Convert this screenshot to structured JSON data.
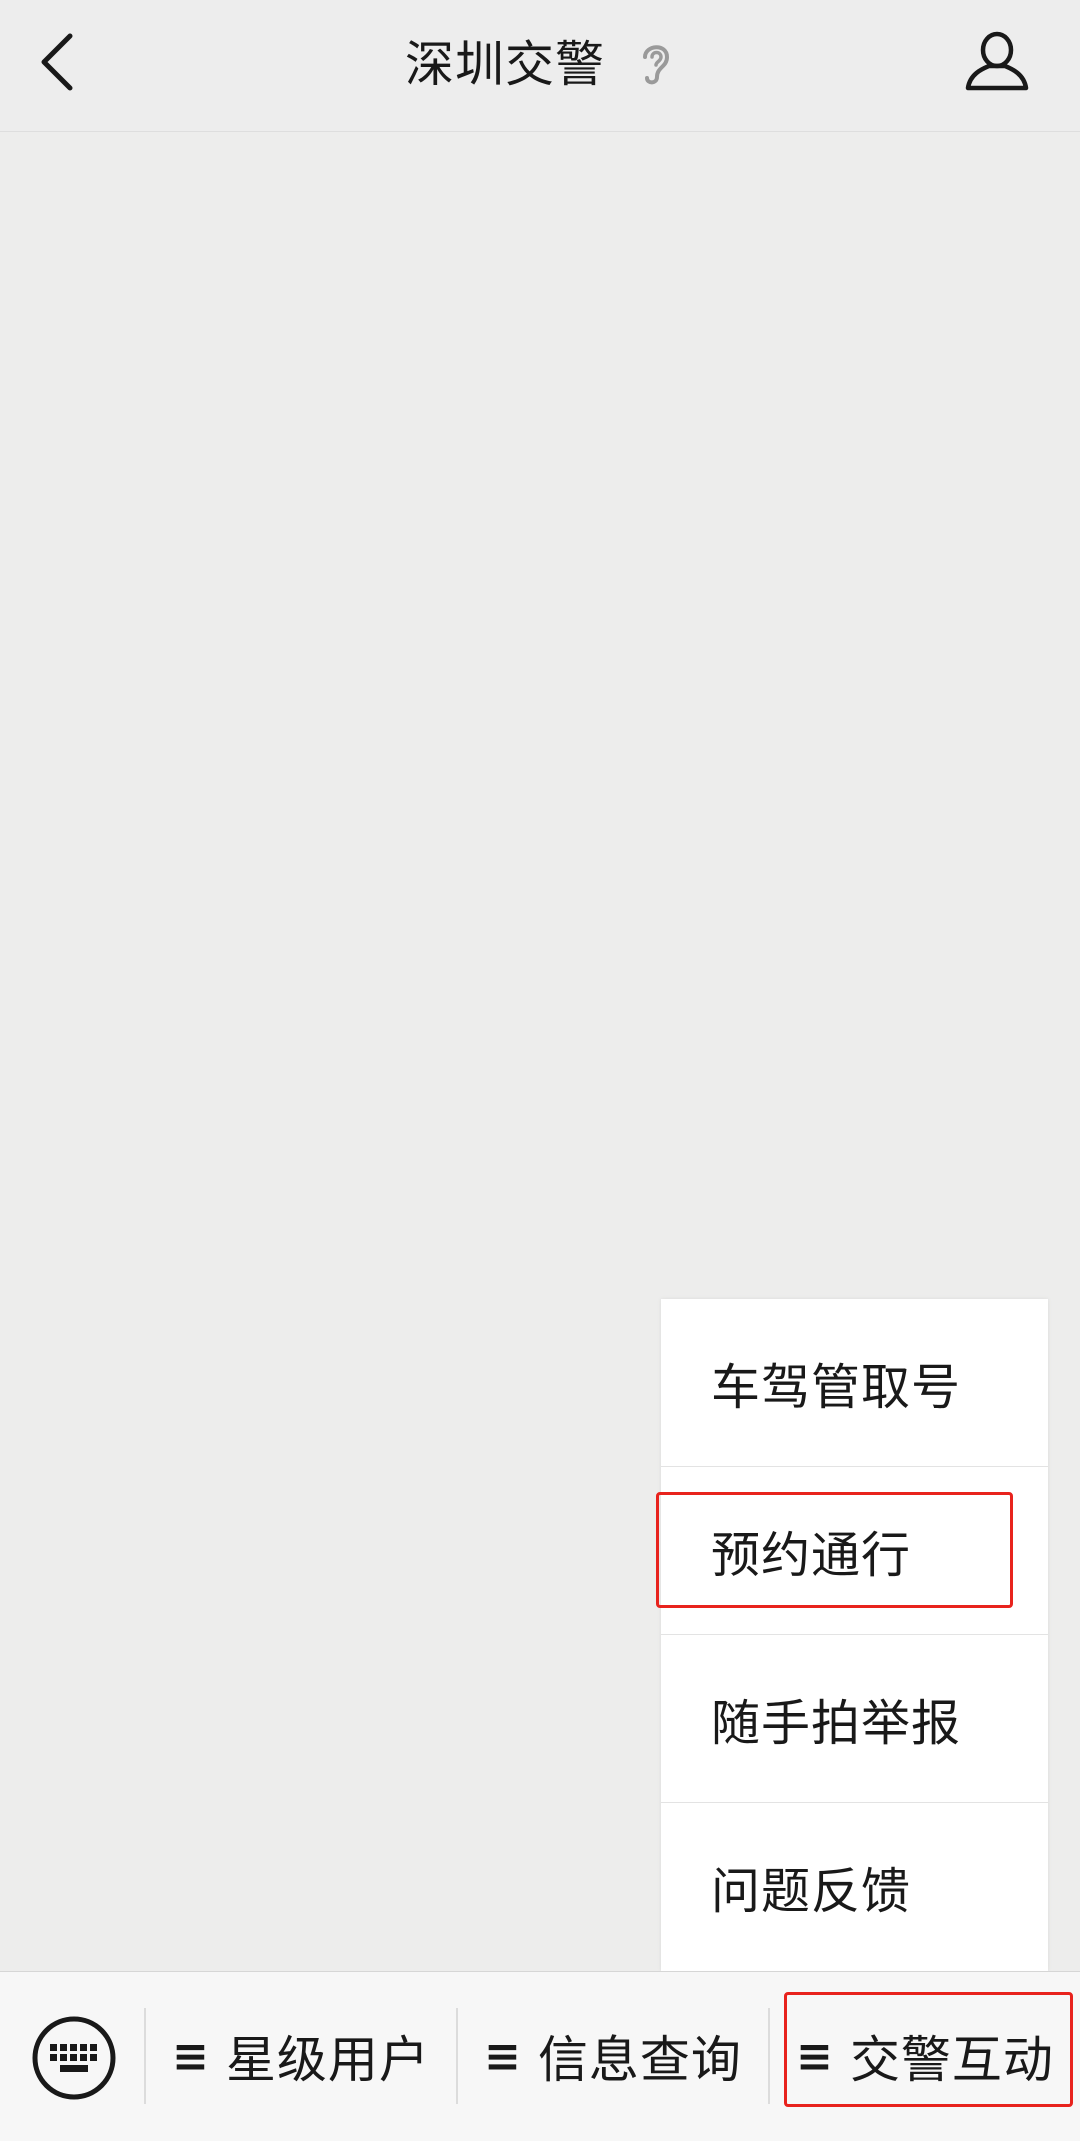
{
  "header": {
    "title": "深圳交警",
    "back_icon": "chevron-left-icon",
    "ear_icon": "ear-icon",
    "profile_icon": "person-icon"
  },
  "popup_menu": {
    "items": [
      {
        "label": "车驾管取号"
      },
      {
        "label": "预约通行"
      },
      {
        "label": "随手拍举报"
      },
      {
        "label": "问题反馈"
      }
    ]
  },
  "bottom_bar": {
    "keyboard_icon": "keyboard-icon",
    "menu_glyph": "≡",
    "tabs": [
      {
        "label": "星级用户"
      },
      {
        "label": "信息查询"
      },
      {
        "label": "交警互动"
      }
    ]
  },
  "colors": {
    "background": "#ededec",
    "highlight": "#e8231d",
    "text": "#191919"
  }
}
